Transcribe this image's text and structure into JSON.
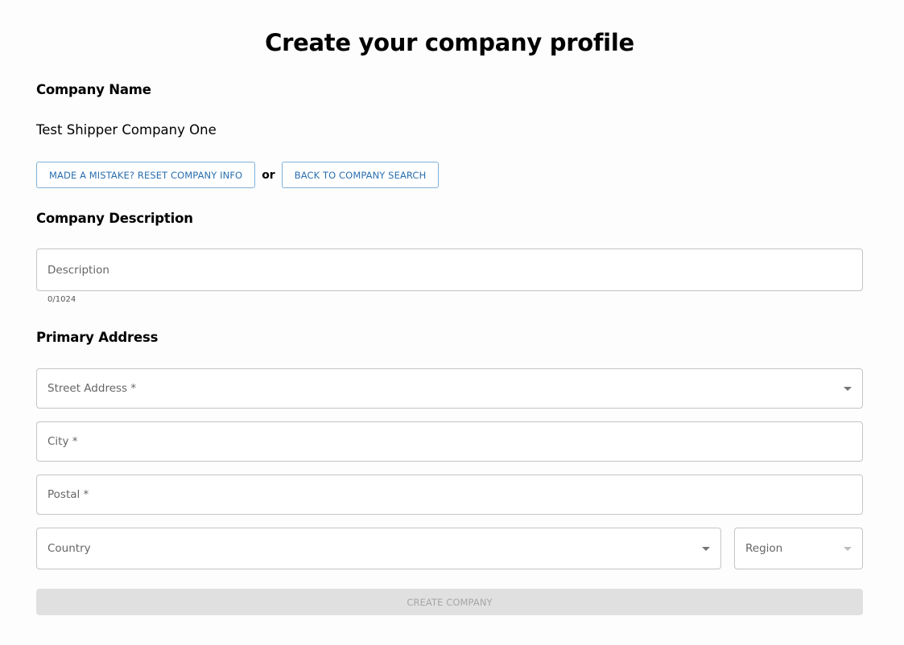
{
  "page": {
    "title": "Create your company profile"
  },
  "company_name": {
    "label": "Company Name",
    "value": "Test Shipper Company One",
    "reset_button": "MADE A MISTAKE? RESET COMPANY INFO",
    "or_text": "or",
    "back_button": "BACK TO COMPANY SEARCH"
  },
  "description": {
    "label": "Company Description",
    "placeholder": "Description",
    "counter": "0/1024"
  },
  "address": {
    "label": "Primary Address",
    "street_placeholder": "Street Address *",
    "city_placeholder": "City *",
    "postal_placeholder": "Postal *",
    "country_placeholder": "Country",
    "region_placeholder": "Region"
  },
  "submit": {
    "label": "CREATE COMPANY",
    "disabled": true
  },
  "icons": {
    "street_dropdown": "chevron-down-icon",
    "country_dropdown": "chevron-down-icon",
    "region_dropdown": "chevron-down-icon"
  },
  "colors": {
    "accent": "#2a6fb0",
    "button_border": "#7fb0d8",
    "field_border": "#c4c4c4",
    "disabled_bg": "#e0e0e0",
    "disabled_text": "#a6a6a6"
  }
}
